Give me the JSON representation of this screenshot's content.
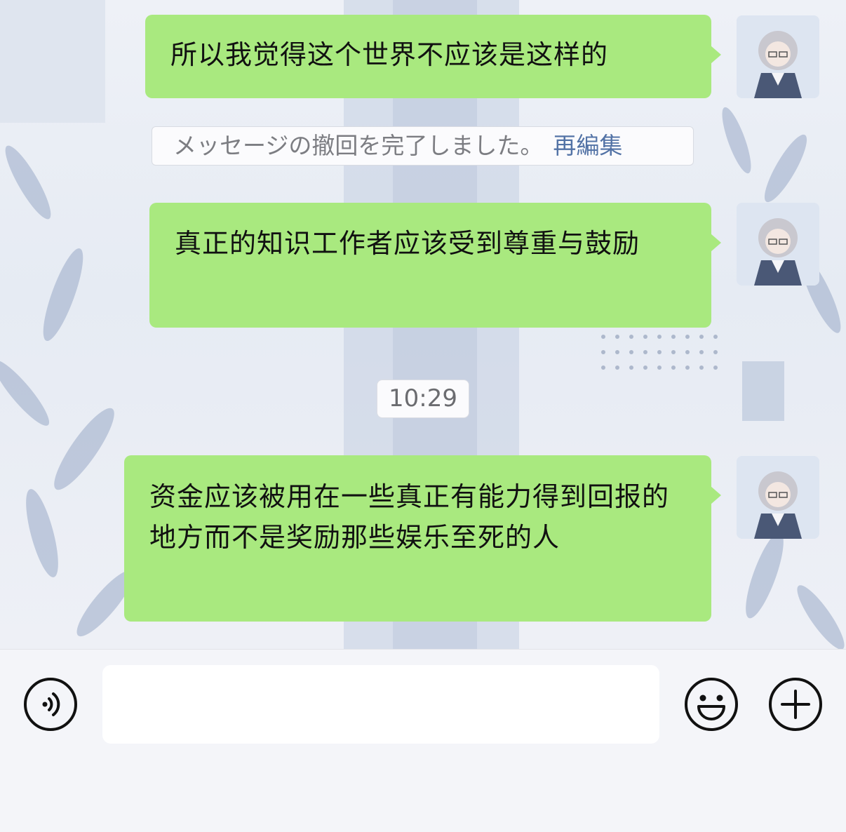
{
  "chat": {
    "messages": [
      {
        "text": "所以我觉得这个世界不应该是这样的"
      },
      {
        "text": "真正的知识工作者应该受到尊重与鼓励"
      },
      {
        "text": "资金应该被用在一些真正有能力得到回报的地方而不是奖励那些娱乐至死的人"
      }
    ],
    "recall_notice": {
      "text": "メッセージの撤回を完了しました。",
      "reedit_label": "再編集"
    },
    "timestamp": "10:29"
  },
  "input_bar": {
    "voice_icon": "voice-icon",
    "emoji_icon": "emoji-icon",
    "plus_icon": "plus-icon",
    "text_value": ""
  },
  "colors": {
    "bubble_green": "#a9e97f",
    "background": "#e8ecf4",
    "input_bar": "#f4f5f9",
    "link_blue": "#5373a6"
  }
}
